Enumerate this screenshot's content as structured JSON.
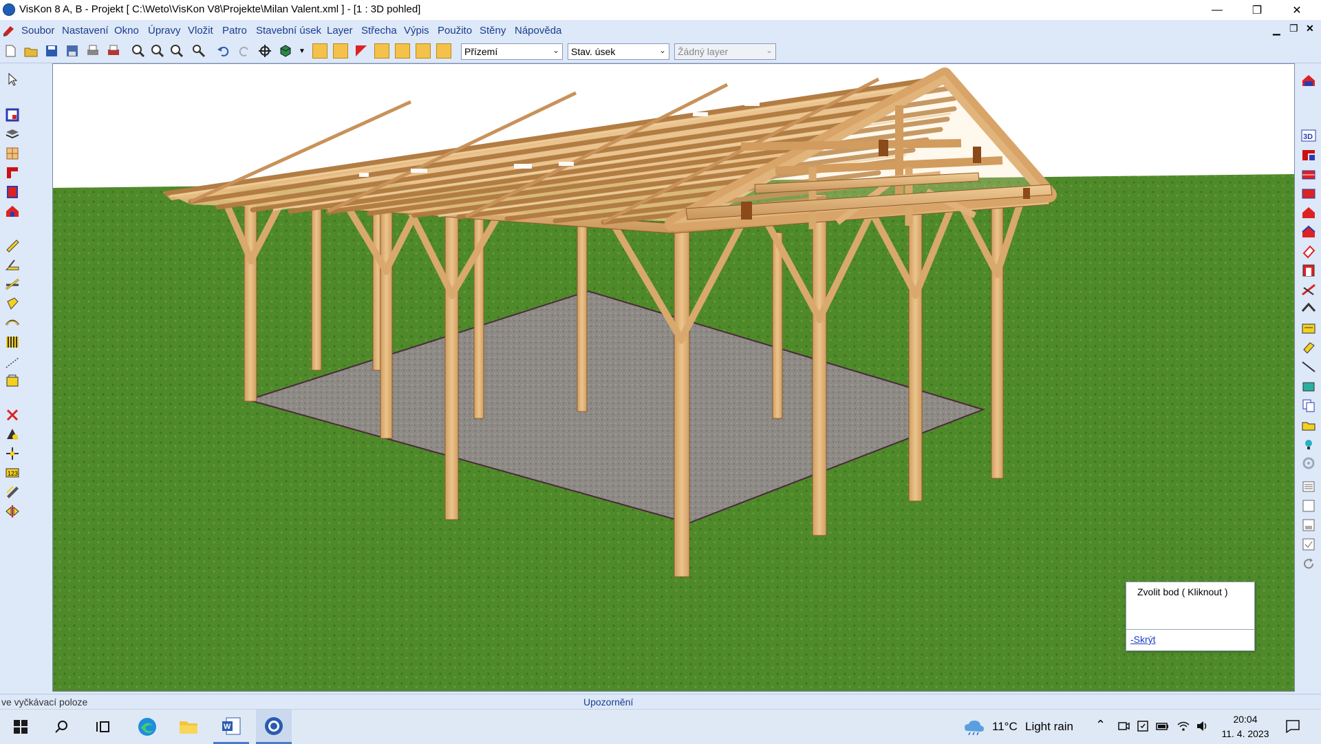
{
  "window": {
    "title": "VisKon 8 A, B - Projekt [ C:\\Weto\\VisKon V8\\Projekte\\Milan Valent.xml ]  - [1 : 3D pohled]"
  },
  "menu": [
    "Soubor",
    "Nastavení",
    "Okno",
    "Úpravy",
    "Vložit",
    "Patro",
    "Stavební úsek",
    "Layer",
    "Střecha",
    "Výpis",
    "Použito",
    "Stěny",
    "Nápověda"
  ],
  "toolbar": {
    "floor_select": "Přízemí",
    "section_select": "Stav. úsek",
    "layer_select": "Žádný layer"
  },
  "popup": {
    "message": "Zvolit bod ( Kliknout )",
    "hide_link": "-Skrýt"
  },
  "status": {
    "left": "ve vyčkávací poloze",
    "center": "Upozornění"
  },
  "taskbar": {
    "weather_temp": "11°C",
    "weather_text": "Light rain",
    "time": "20:04",
    "date": "11. 4. 2023"
  },
  "colors": {
    "accent_menu": "#1a3c8c",
    "grass": "#4f8a2a",
    "wood": "#e2b77a",
    "floor": "#8e8a85"
  }
}
